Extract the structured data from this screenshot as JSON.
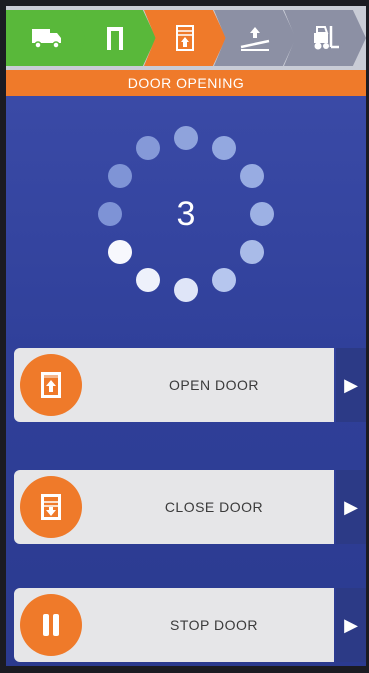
{
  "steps": [
    {
      "icon": "truck-icon",
      "state": "completed"
    },
    {
      "icon": "door-frame-icon",
      "state": "completed"
    },
    {
      "icon": "door-opening-icon",
      "state": "active"
    },
    {
      "icon": "ramp-up-icon",
      "state": "pending"
    },
    {
      "icon": "forklift-icon",
      "state": "pending"
    }
  ],
  "header": {
    "title": "DOOR OPENING"
  },
  "spinner": {
    "countdown": "3"
  },
  "actions": [
    {
      "label": "OPEN DOOR",
      "icon": "door-open-icon",
      "arrow": "▶"
    },
    {
      "label": "CLOSE DOOR",
      "icon": "door-close-icon",
      "arrow": "▶"
    },
    {
      "label": "STOP DOOR",
      "icon": "pause-icon",
      "arrow": "▶"
    }
  ],
  "colors": {
    "accent": "#ef7a2a",
    "completed": "#59b83a",
    "panel": "#3a4aa6"
  }
}
